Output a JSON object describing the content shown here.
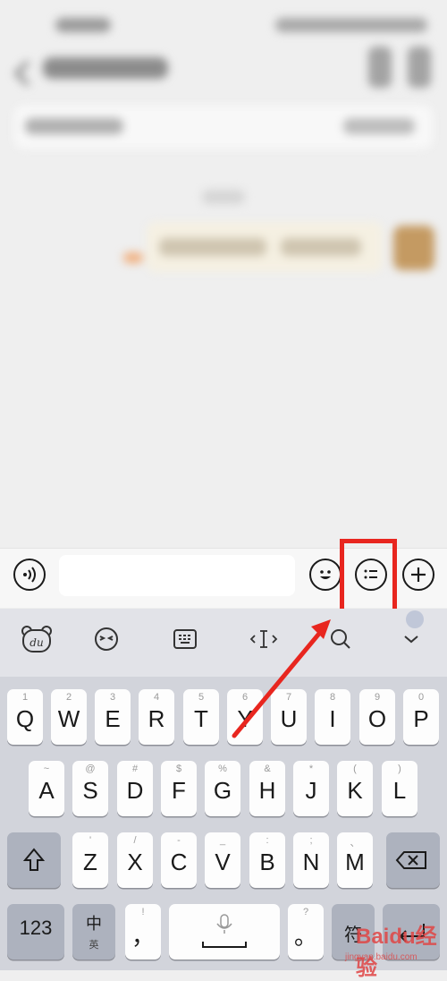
{
  "keyboard": {
    "row1": [
      {
        "letter": "Q",
        "hint": "1"
      },
      {
        "letter": "W",
        "hint": "2"
      },
      {
        "letter": "E",
        "hint": "3"
      },
      {
        "letter": "R",
        "hint": "4"
      },
      {
        "letter": "T",
        "hint": "5"
      },
      {
        "letter": "Y",
        "hint": "6"
      },
      {
        "letter": "U",
        "hint": "7"
      },
      {
        "letter": "I",
        "hint": "8"
      },
      {
        "letter": "O",
        "hint": "9"
      },
      {
        "letter": "P",
        "hint": "0"
      }
    ],
    "row2": [
      {
        "letter": "A",
        "hint": "~"
      },
      {
        "letter": "S",
        "hint": "@"
      },
      {
        "letter": "D",
        "hint": "#"
      },
      {
        "letter": "F",
        "hint": "$"
      },
      {
        "letter": "G",
        "hint": "%"
      },
      {
        "letter": "H",
        "hint": "&"
      },
      {
        "letter": "J",
        "hint": "*"
      },
      {
        "letter": "K",
        "hint": "("
      },
      {
        "letter": "L",
        "hint": ")"
      }
    ],
    "row3": [
      {
        "letter": "Z",
        "hint": "'"
      },
      {
        "letter": "X",
        "hint": "/"
      },
      {
        "letter": "C",
        "hint": "-"
      },
      {
        "letter": "V",
        "hint": "_"
      },
      {
        "letter": "B",
        "hint": ":"
      },
      {
        "letter": "N",
        "hint": ";"
      },
      {
        "letter": "M",
        "hint": "、"
      }
    ],
    "num_label": "123",
    "lang_main": "中",
    "lang_sub": "英",
    "comma_hint": "!",
    "comma": "，",
    "period_hint": "?",
    "period": "。",
    "symbol_key": "符"
  },
  "watermark": {
    "brand": "Baidu经验",
    "url": "jingyan.baidu.com"
  },
  "colors": {
    "highlight": "#e8261f",
    "keyboard_bg": "#d2d4db",
    "key_bg": "#fdfdfd",
    "func_key_bg": "#adb2be"
  },
  "icons": {
    "toolbar": [
      "voice-icon",
      "emoji-icon",
      "quick-reply-list-icon",
      "add-icon"
    ],
    "suggestion_bar": [
      "du-bear-logo-icon",
      "wink-face-icon",
      "keyboard-icon",
      "cursor-icon",
      "search-icon",
      "chevron-down-icon"
    ]
  }
}
